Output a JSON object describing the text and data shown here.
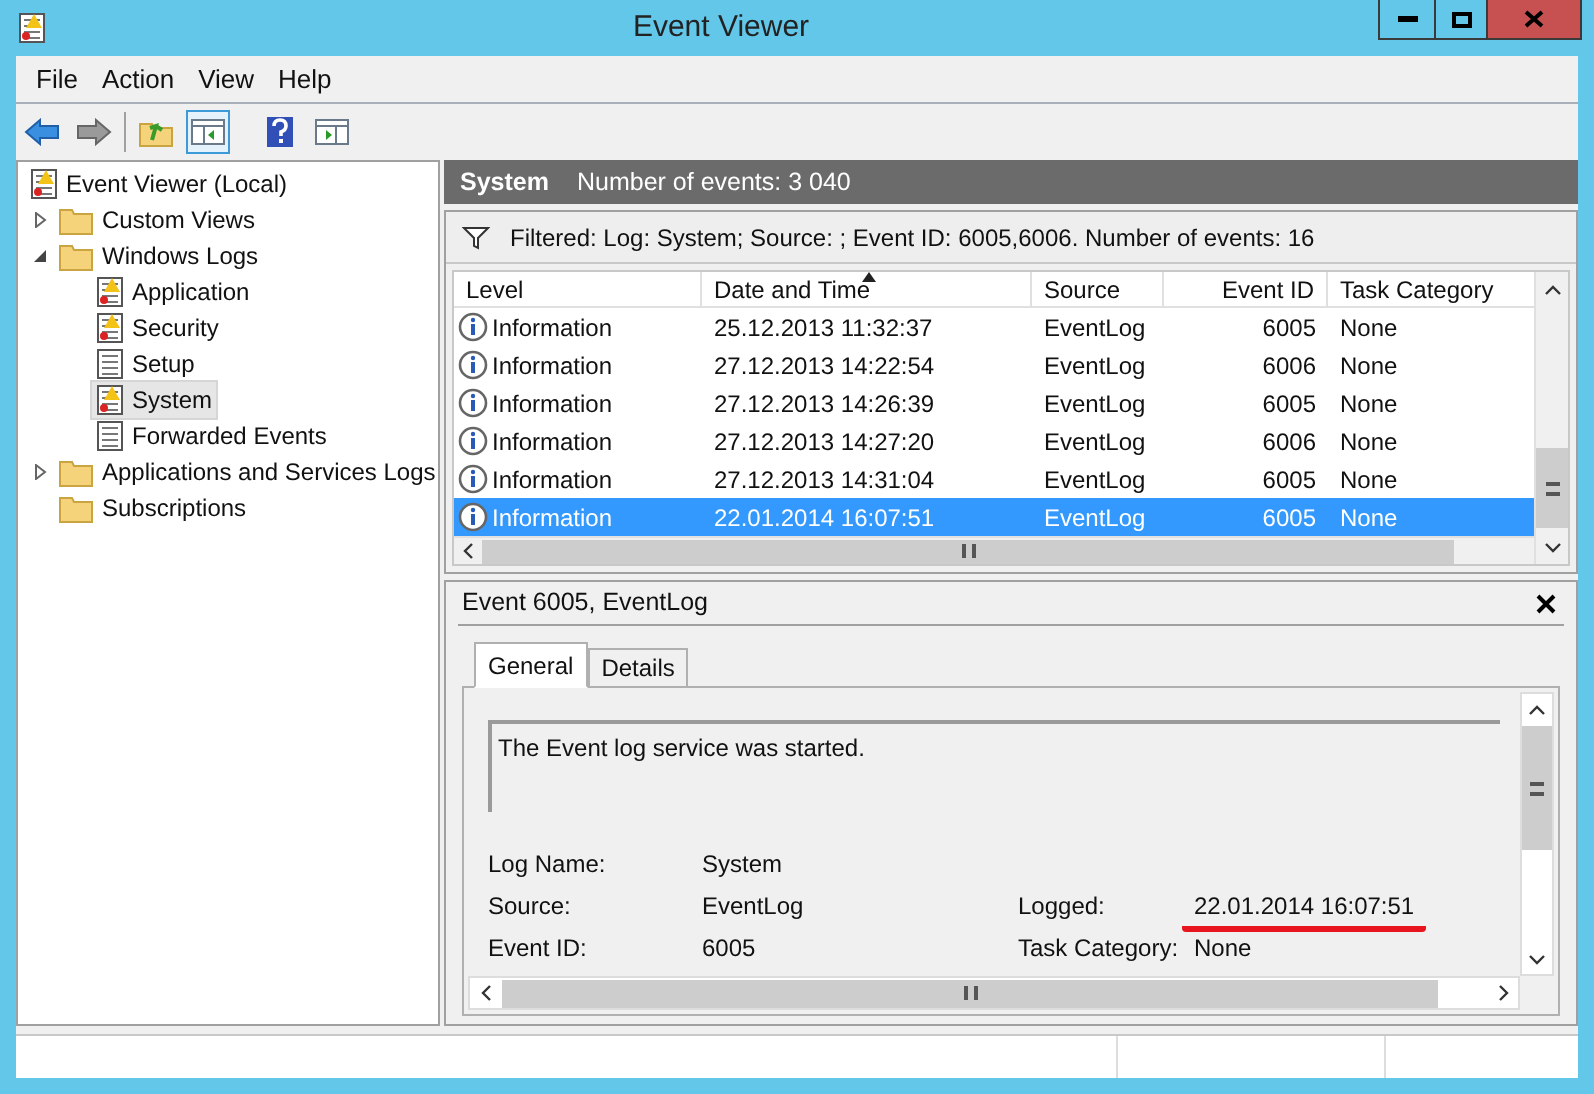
{
  "window": {
    "title": "Event Viewer"
  },
  "menu": [
    "File",
    "Action",
    "View",
    "Help"
  ],
  "toolbar": [
    {
      "kind": "back",
      "selected": false
    },
    {
      "kind": "forward",
      "selected": false
    },
    {
      "kind": "up",
      "selected": false
    },
    {
      "kind": "pane",
      "selected": true
    },
    {
      "kind": "help",
      "selected": false
    },
    {
      "kind": "action-pane",
      "selected": false
    }
  ],
  "tree": [
    {
      "label": "Event Viewer (Local)",
      "kind": "log",
      "selected": false,
      "children": [
        {
          "label": "Custom Views",
          "kind": "folder",
          "expanded": false,
          "selected": false
        },
        {
          "label": "Windows Logs",
          "kind": "folder",
          "expanded": true,
          "selected": false,
          "children": [
            {
              "label": "Application",
              "kind": "log",
              "selected": false
            },
            {
              "label": "Security",
              "kind": "log",
              "selected": false
            },
            {
              "label": "Setup",
              "kind": "plain",
              "selected": false
            },
            {
              "label": "System",
              "kind": "log",
              "selected": true
            },
            {
              "label": "Forwarded Events",
              "kind": "plain",
              "selected": false
            }
          ]
        },
        {
          "label": "Applications and Services Logs",
          "kind": "folder",
          "expanded": false,
          "selected": false
        },
        {
          "label": "Subscriptions",
          "kind": "folder",
          "selected": false
        }
      ]
    }
  ],
  "header": {
    "title": "System",
    "count": "Number of events: 3 040"
  },
  "filter": "Filtered: Log: System; Source: ; Event ID: 6005,6006. Number of events: 16",
  "table": {
    "columns": [
      "Level",
      "Date and Time",
      "Source",
      "Event ID",
      "Task Category"
    ],
    "rows": [
      {
        "level": "Information",
        "date": "25.12.2013 11:32:37",
        "source": "EventLog",
        "id": "6005",
        "category": "None",
        "selected": false
      },
      {
        "level": "Information",
        "date": "27.12.2013 14:22:54",
        "source": "EventLog",
        "id": "6006",
        "category": "None",
        "selected": false
      },
      {
        "level": "Information",
        "date": "27.12.2013 14:26:39",
        "source": "EventLog",
        "id": "6005",
        "category": "None",
        "selected": false
      },
      {
        "level": "Information",
        "date": "27.12.2013 14:27:20",
        "source": "EventLog",
        "id": "6006",
        "category": "None",
        "selected": false
      },
      {
        "level": "Information",
        "date": "27.12.2013 14:31:04",
        "source": "EventLog",
        "id": "6005",
        "category": "None",
        "selected": false
      },
      {
        "level": "Information",
        "date": "22.01.2014 16:07:51",
        "source": "EventLog",
        "id": "6005",
        "category": "None",
        "selected": true
      }
    ]
  },
  "details": {
    "title": "Event 6005, EventLog",
    "tabs": [
      {
        "label": "General",
        "selected": true
      },
      {
        "label": "Details",
        "selected": false
      }
    ],
    "message": "The Event log service was started.",
    "fields": [
      [
        {
          "label": "Log Name:",
          "value": "System",
          "highlighted": false
        }
      ],
      [
        {
          "label": "Source:",
          "value": "EventLog",
          "highlighted": false
        },
        {
          "label": "Logged:",
          "value": "22.01.2014 16:07:51",
          "highlighted": true
        }
      ],
      [
        {
          "label": "Event ID:",
          "value": "6005",
          "highlighted": false
        },
        {
          "label": "Task Category:",
          "value": "None",
          "highlighted": false
        }
      ]
    ]
  }
}
